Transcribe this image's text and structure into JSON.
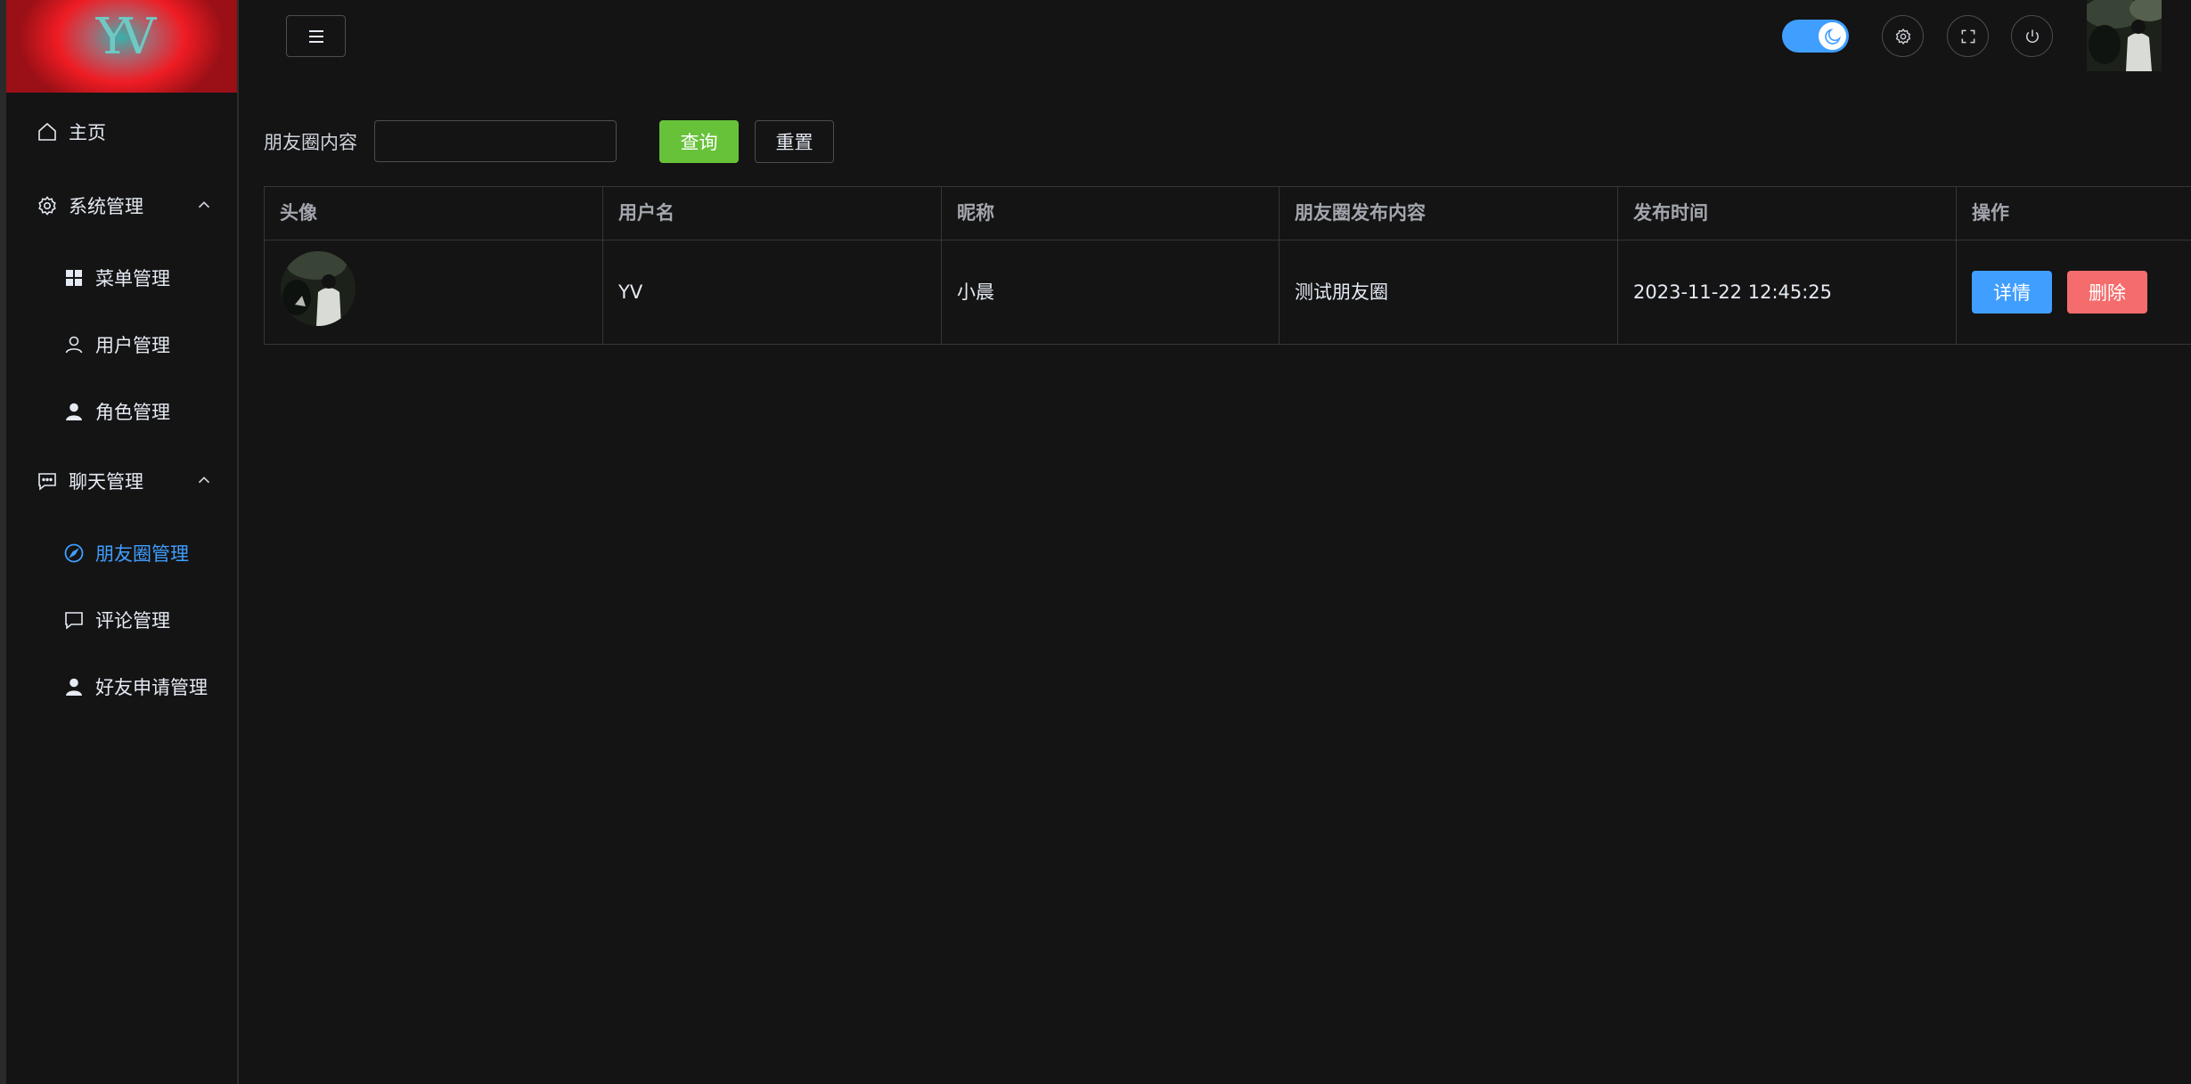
{
  "sidebar": {
    "logo": "YV",
    "items": [
      {
        "label": "主页",
        "icon": "home-icon"
      },
      {
        "label": "系统管理",
        "icon": "gear-icon",
        "expanded": true
      },
      {
        "label": "菜单管理",
        "icon": "grid-icon"
      },
      {
        "label": "用户管理",
        "icon": "user-outline-icon"
      },
      {
        "label": "角色管理",
        "icon": "user-filled-icon"
      },
      {
        "label": "聊天管理",
        "icon": "chat-icon",
        "expanded": true
      },
      {
        "label": "朋友圈管理",
        "icon": "compass-icon",
        "active": true
      },
      {
        "label": "评论管理",
        "icon": "comment-icon"
      },
      {
        "label": "好友申请管理",
        "icon": "user-filled-icon"
      }
    ]
  },
  "header": {
    "menu_toggle_icon": "hamburger-icon",
    "theme": {
      "mode": "dark",
      "icon": "moon-icon"
    },
    "buttons": [
      "settings-icon",
      "fullscreen-icon",
      "power-icon"
    ]
  },
  "search": {
    "label": "朋友圈内容",
    "value": "",
    "query_label": "查询",
    "reset_label": "重置"
  },
  "table": {
    "headers": [
      "头像",
      "用户名",
      "昵称",
      "朋友圈发布内容",
      "发布时间",
      "操作"
    ],
    "rows": [
      {
        "username": "YV",
        "nickname": "小晨",
        "content": "测试朋友圈",
        "time": "2023-11-22 12:45:25",
        "detail_label": "详情",
        "delete_label": "删除"
      }
    ]
  },
  "colors": {
    "background": "#141414",
    "primary": "#409eff",
    "success": "#67c23a",
    "danger": "#f56c6c",
    "border": "#363637"
  }
}
